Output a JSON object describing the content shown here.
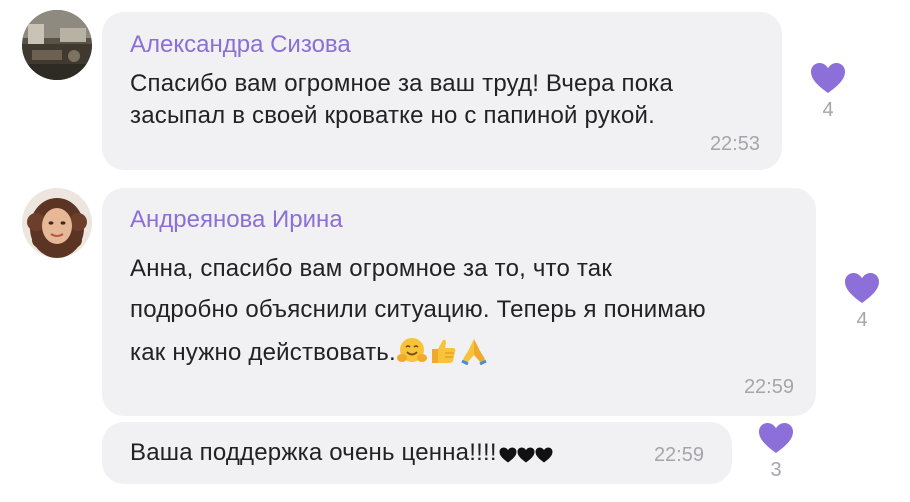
{
  "comments": [
    {
      "author": "Александра Сизова",
      "lines": [
        "Спасибо вам огромное за ваш труд! Вчера пока",
        "засыпал в своей кроватке но с папиной рукой."
      ],
      "time": "22:53",
      "reaction": {
        "icon": "heart-icon",
        "count": "4"
      }
    },
    {
      "author": "Андреянова Ирина",
      "lines": [
        "Анна, спасибо вам огромное за то, что так",
        "подробно объяснили ситуацию. Теперь я понимаю",
        "как нужно действовать."
      ],
      "emojis": [
        "hugging-face-icon",
        "thumbs-up-icon",
        "folded-hands-icon"
      ],
      "time": "22:59",
      "reaction": {
        "icon": "heart-icon",
        "count": "4"
      }
    },
    {
      "author": "",
      "lines": [
        "Ваша поддержка очень ценна!!!!"
      ],
      "inline_icons": [
        "black-heart-icon",
        "black-heart-icon",
        "black-heart-icon"
      ],
      "time": "22:59",
      "reaction": {
        "icon": "heart-icon",
        "count": "3"
      }
    }
  ],
  "colors": {
    "bubble": "#f1f1f3",
    "author": "#8b6fd6",
    "heart": "#8c6fd8",
    "time": "#a5a5ab"
  }
}
